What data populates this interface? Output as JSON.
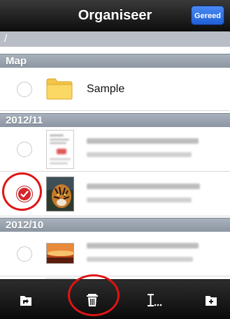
{
  "navbar": {
    "title": "Organiseer",
    "done_label": "Gereed"
  },
  "path": {
    "text": "/"
  },
  "sections": {
    "map": "Map",
    "nov": "2012/11",
    "oct": "2012/10"
  },
  "folder_row": {
    "label": "Sample",
    "icon": "folder-icon"
  },
  "file_rows": [
    {
      "section": "2012/11",
      "selected": false,
      "thumbnail": "document-thumbnail"
    },
    {
      "section": "2012/11",
      "selected": true,
      "thumbnail": "tiger-photo-thumbnail"
    },
    {
      "section": "2012/10",
      "selected": false,
      "thumbnail": "sunset-photo-thumbnail"
    }
  ],
  "toolbar": {
    "buttons": [
      "move-icon",
      "trash-icon",
      "rename-icon",
      "new-folder-icon"
    ]
  },
  "colors": {
    "accent": "#1f5fd6",
    "highlight": "#e01414",
    "section": "#97a1ad"
  }
}
